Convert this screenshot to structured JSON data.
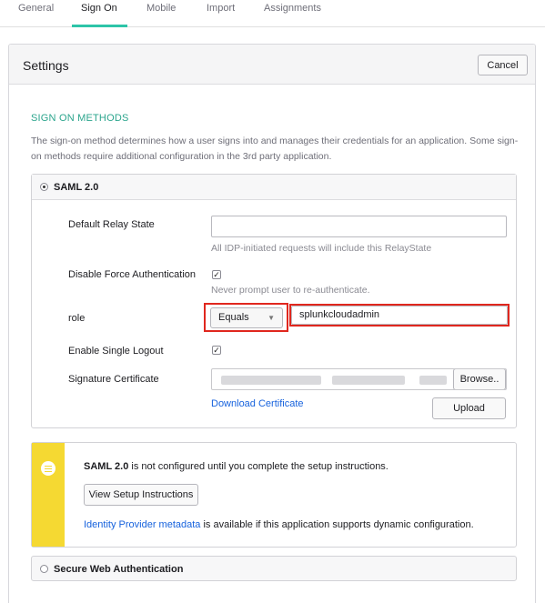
{
  "tabs": [
    {
      "label": "General"
    },
    {
      "label": "Sign On"
    },
    {
      "label": "Mobile"
    },
    {
      "label": "Import"
    },
    {
      "label": "Assignments"
    }
  ],
  "settings": {
    "title": "Settings",
    "cancel_label": "Cancel",
    "section_title": "SIGN ON METHODS",
    "section_desc": "The sign-on method determines how a user signs into and manages their credentials for an application. Some sign-on methods require additional configuration in the 3rd party application."
  },
  "saml": {
    "label": "SAML 2.0",
    "relay_state_label": "Default Relay State",
    "relay_state_value": "",
    "relay_state_hint": "All IDP-initiated requests will include this RelayState",
    "force_auth_label": "Disable Force Authentication",
    "force_auth_hint": "Never prompt user to re-authenticate.",
    "role_label": "role",
    "role_operator": "Equals",
    "role_value": "splunkcloudadmin",
    "single_logout_label": "Enable Single Logout",
    "signature_label": "Signature Certificate",
    "browse_label": "Browse..",
    "download_label": "Download Certificate",
    "upload_label": "Upload"
  },
  "notice": {
    "bold": "SAML 2.0",
    "text": " is not configured until you complete the setup instructions.",
    "button_label": "View Setup Instructions",
    "metadata_link": "Identity Provider metadata",
    "metadata_text": " is available if this application supports dynamic configuration."
  },
  "swa": {
    "label": "Secure Web Authentication"
  },
  "colors": {
    "accent": "#2dc4a8",
    "section_title": "#2ca58d",
    "link": "#1662dd",
    "highlight": "#e0271e",
    "notice_bar": "#f5d932"
  },
  "icons": [
    "radio-selected-icon",
    "checkbox-checked-icon",
    "dropdown-arrow-icon",
    "list-icon",
    "radio-unselected-icon"
  ]
}
